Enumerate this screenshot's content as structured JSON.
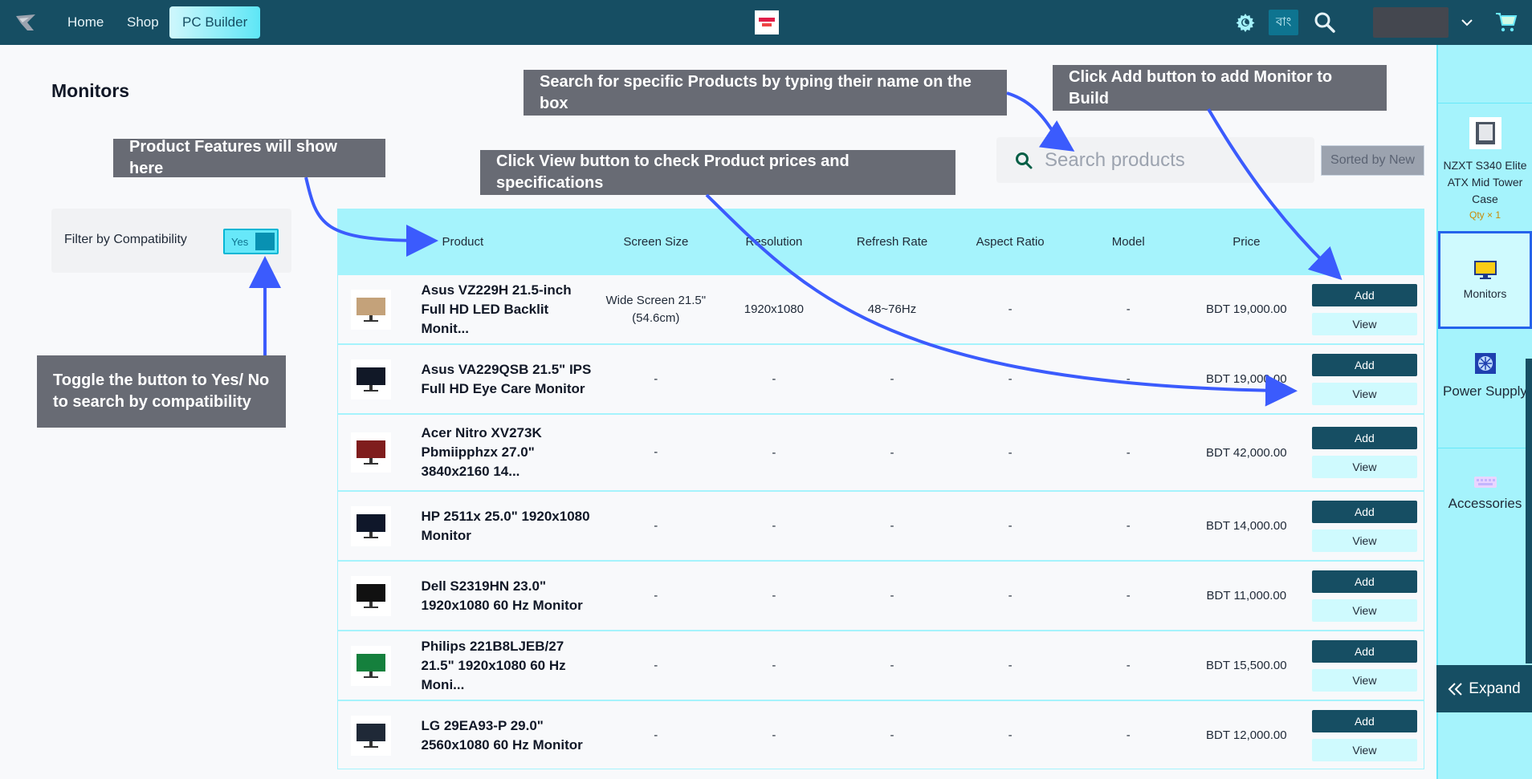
{
  "nav": {
    "links": [
      {
        "label": "Home",
        "active": false
      },
      {
        "label": "Shop",
        "active": false
      },
      {
        "label": "PC Builder",
        "active": true
      }
    ],
    "lang_label": "বাং",
    "icons": [
      "logo-icon",
      "theme-toggle-icon",
      "search-icon",
      "chevron-down-icon",
      "cart-icon"
    ]
  },
  "page": {
    "title": "Monitors"
  },
  "filter": {
    "label": "Filter by Compatibility",
    "toggle_value": "Yes"
  },
  "search": {
    "placeholder": "Search products",
    "value": ""
  },
  "sort": {
    "label": "Sorted by New"
  },
  "table": {
    "headers": [
      "Product",
      "Screen Size",
      "Resolution",
      "Refresh Rate",
      "Aspect Ratio",
      "Model",
      "Price"
    ],
    "add_label": "Add",
    "view_label": "View",
    "rows": [
      {
        "name": "Asus VZ229H 21.5-inch Full HD LED Backlit Monit...",
        "screen_size": "Wide Screen 21.5\"(54.6cm)",
        "resolution": "1920x1080",
        "refresh_rate": "48~76Hz",
        "aspect_ratio": "-",
        "model": "-",
        "price": "BDT 19,000.00"
      },
      {
        "name": "Asus VA229QSB 21.5\" IPS Full HD Eye Care Monitor",
        "screen_size": "-",
        "resolution": "-",
        "refresh_rate": "-",
        "aspect_ratio": "-",
        "model": "-",
        "price": "BDT 19,000.00"
      },
      {
        "name": "Acer Nitro XV273K Pbmiipphzx 27.0\" 3840x2160 14...",
        "screen_size": "-",
        "resolution": "-",
        "refresh_rate": "-",
        "aspect_ratio": "-",
        "model": "-",
        "price": "BDT 42,000.00"
      },
      {
        "name": "HP 2511x 25.0\" 1920x1080 Monitor",
        "screen_size": "-",
        "resolution": "-",
        "refresh_rate": "-",
        "aspect_ratio": "-",
        "model": "-",
        "price": "BDT 14,000.00"
      },
      {
        "name": "Dell S2319HN 23.0\" 1920x1080 60 Hz Monitor",
        "screen_size": "-",
        "resolution": "-",
        "refresh_rate": "-",
        "aspect_ratio": "-",
        "model": "-",
        "price": "BDT 11,000.00"
      },
      {
        "name": "Philips 221B8LJEB/27 21.5\" 1920x1080 60 Hz Moni...",
        "screen_size": "-",
        "resolution": "-",
        "refresh_rate": "-",
        "aspect_ratio": "-",
        "model": "-",
        "price": "BDT 15,500.00"
      },
      {
        "name": "LG 29EA93-P 29.0\" 2560x1080 60 Hz Monitor",
        "screen_size": "-",
        "resolution": "-",
        "refresh_rate": "-",
        "aspect_ratio": "-",
        "model": "-",
        "price": "BDT 12,000.00"
      }
    ]
  },
  "sidebar": {
    "items": [
      {
        "label": "NZXT S340 Elite ATX Mid Tower Case",
        "qty": "Qty × 1",
        "icon": "case-icon"
      },
      {
        "label": "Monitors",
        "icon": "monitor-icon",
        "active": true
      },
      {
        "label": "Power Supply",
        "icon": "power-supply-icon"
      },
      {
        "label": "Accessories",
        "icon": "keyboard-icon"
      }
    ],
    "expand_label": "Expand"
  },
  "callouts": {
    "search": "Search for specific Products by typing their name on the box",
    "add": "Click Add button to add Monitor to Build",
    "features": "Product Features will show here",
    "view": "Click View button to check Product prices and specifications",
    "toggle": "Toggle the button to Yes/ No to search by compatibility"
  },
  "colors": {
    "topbar": "#164e63",
    "accent": "#a5f3fc",
    "callout": "#686b74",
    "arrow": "#3b5bfd"
  }
}
